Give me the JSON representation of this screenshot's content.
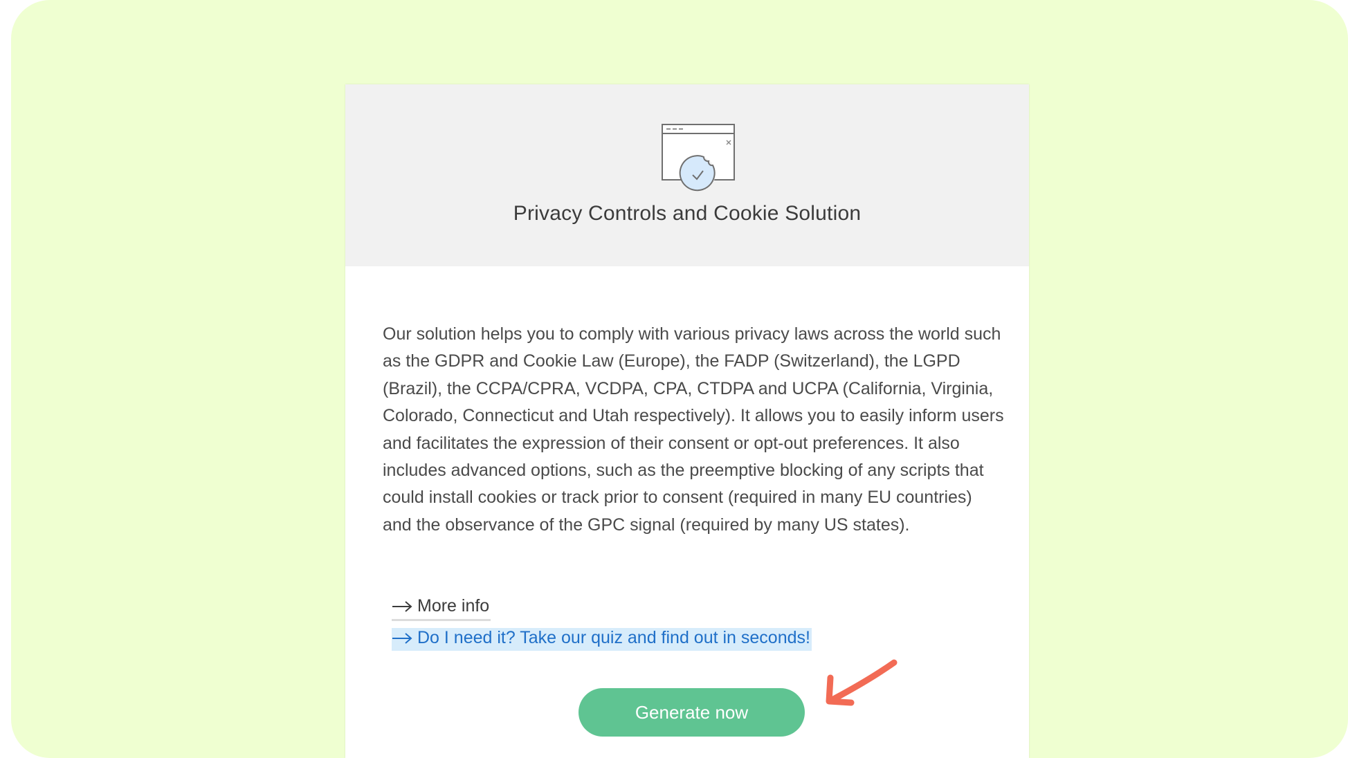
{
  "card": {
    "title": "Privacy Controls and Cookie Solution",
    "description": "Our solution helps you to comply with various privacy laws across the world such as the GDPR and Cookie Law (Europe), the FADP (Switzerland), the LGPD (Brazil), the CCPA/CPRA, VCDPA, CPA, CTDPA and UCPA (California, Virginia, Colorado, Connecticut and Utah respectively). It allows you to easily inform users and facilitates the expression of their consent or opt-out preferences. It also includes advanced options, such as the preemptive blocking of any scripts that could install cookies or track prior to consent (required in many EU countries) and the observance of the GPC signal (required by many US states).",
    "hero_icon": "browser-window-cookie-check-icon",
    "links": {
      "more_info": "More info",
      "quiz": "Do I need it? Take our quiz and find out in seconds!"
    },
    "generate_label": "Generate now"
  },
  "colors": {
    "background": "#efffd1",
    "header_bg": "#f1f1f1",
    "button": "#5fc492",
    "link_blue": "#1f6fc8",
    "pointer_arrow": "#f26b55"
  },
  "icons": {
    "link_arrow": "arrow-right-icon",
    "annotation": "red-pointer-arrow-icon"
  }
}
